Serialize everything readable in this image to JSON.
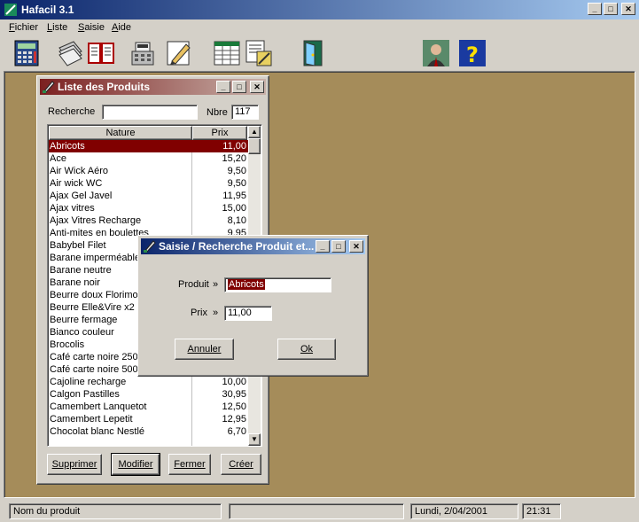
{
  "app": {
    "title": "Hafacil  3.1"
  },
  "menu": [
    {
      "id": "fichier",
      "label": "Fichier"
    },
    {
      "id": "liste",
      "label": "Liste"
    },
    {
      "id": "saisie",
      "label": "Saisie"
    },
    {
      "id": "aide",
      "label": "Aide"
    }
  ],
  "toolbar": [
    {
      "id": "calculator",
      "icon": "calculator-icon"
    },
    {
      "id": "notebook",
      "icon": "notebook-icon"
    },
    {
      "id": "book",
      "icon": "book-icon"
    },
    {
      "id": "cash-register",
      "icon": "cash-register-icon"
    },
    {
      "id": "edit",
      "icon": "edit-pencil-icon"
    },
    {
      "id": "spreadsheet",
      "icon": "spreadsheet-icon"
    },
    {
      "id": "report",
      "icon": "report-icon"
    },
    {
      "id": "exit-door",
      "icon": "door-icon"
    },
    {
      "id": "user",
      "icon": "user-portrait-icon"
    },
    {
      "id": "help",
      "icon": "help-icon"
    }
  ],
  "product_list": {
    "title": "Liste des Produits",
    "search_label": "Recherche",
    "search_value": "",
    "count_label": "Nbre",
    "count_value": "117",
    "columns": [
      "Nature",
      "Prix"
    ],
    "rows": [
      {
        "name": "Abricots",
        "price": "11,00",
        "selected": true
      },
      {
        "name": "Ace",
        "price": "15,20"
      },
      {
        "name": "Air Wick Aéro",
        "price": "9,50"
      },
      {
        "name": "Air wick WC",
        "price": "9,50"
      },
      {
        "name": "Ajax Gel Javel",
        "price": "11,95"
      },
      {
        "name": "Ajax vitres",
        "price": "15,00"
      },
      {
        "name": "Ajax Vitres Recharge",
        "price": "8,10"
      },
      {
        "name": "Anti-mites en boulettes",
        "price": "9,95"
      },
      {
        "name": "Babybel Filet",
        "price": ""
      },
      {
        "name": "Barane imperméable",
        "price": ""
      },
      {
        "name": "Barane neutre",
        "price": ""
      },
      {
        "name": "Barane noir",
        "price": ""
      },
      {
        "name": "Beurre doux Florimond",
        "price": ""
      },
      {
        "name": "Beurre Elle&Vire x2",
        "price": ""
      },
      {
        "name": "Beurre fermage",
        "price": ""
      },
      {
        "name": "Bianco couleur",
        "price": ""
      },
      {
        "name": "Brocolis",
        "price": ""
      },
      {
        "name": "Café carte noire 250",
        "price": ""
      },
      {
        "name": "Café carte noire 500",
        "price": ""
      },
      {
        "name": "Cajoline recharge",
        "price": "10,00"
      },
      {
        "name": "Calgon Pastilles",
        "price": "30,95"
      },
      {
        "name": "Camembert Lanquetot",
        "price": "12,50"
      },
      {
        "name": "Camembert Lepetit",
        "price": "12,95"
      },
      {
        "name": "Chocolat blanc Nestlé",
        "price": "6,70"
      }
    ],
    "buttons": {
      "delete": "Supprimer",
      "modify": "Modifier",
      "close": "Fermer",
      "create": "Créer"
    }
  },
  "dialog": {
    "title": "Saisie / Recherche Produit et...",
    "product_label": "Produit",
    "product_arrow": "»",
    "product_value": "Abricots",
    "price_label": "Prix",
    "price_arrow": "»",
    "price_value": "11,00",
    "cancel": "Annuler",
    "ok": "Ok"
  },
  "status": {
    "field_hint": "Nom du produit",
    "middle": "",
    "date": "Lundi, 2/04/2001",
    "time": "21:31"
  },
  "colors": {
    "workspace": "#a58c5a",
    "list_title": "#7b2020",
    "selection": "#800000",
    "active_title": "#0a246a"
  }
}
